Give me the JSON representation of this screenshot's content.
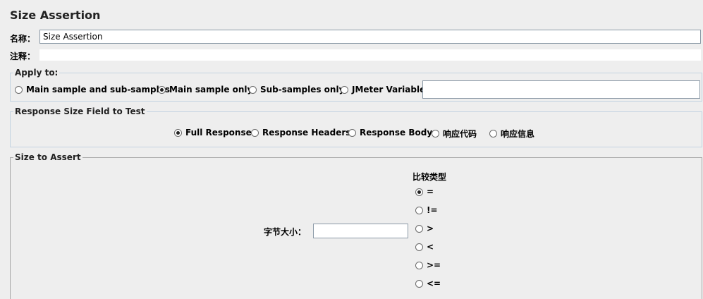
{
  "title": "Size Assertion",
  "name_label": "名称：",
  "name_value": "Size Assertion",
  "comment_label": "注释：",
  "comment_value": "",
  "apply_to": {
    "legend": "Apply to:",
    "options": [
      {
        "label": "Main sample and sub-samples",
        "selected": false
      },
      {
        "label": "Main sample only",
        "selected": true
      },
      {
        "label": "Sub-samples only",
        "selected": false
      },
      {
        "label": "JMeter Variable",
        "selected": false
      }
    ],
    "variable_value": ""
  },
  "response_field": {
    "legend": "Response Size Field to Test",
    "options": [
      {
        "label": "Full Response",
        "selected": true
      },
      {
        "label": "Response Headers",
        "selected": false
      },
      {
        "label": "Response Body",
        "selected": false
      },
      {
        "label": "响应代码",
        "selected": false
      },
      {
        "label": "响应信息",
        "selected": false
      }
    ]
  },
  "size_assert": {
    "legend": "Size to Assert",
    "size_label": "字节大小：",
    "size_value": "",
    "comparison_title": "比较类型",
    "comparisons": [
      {
        "label": "=",
        "selected": true
      },
      {
        "label": "!=",
        "selected": false
      },
      {
        "label": ">",
        "selected": false
      },
      {
        "label": "<",
        "selected": false
      },
      {
        "label": ">=",
        "selected": false
      },
      {
        "label": "<=",
        "selected": false
      }
    ]
  }
}
